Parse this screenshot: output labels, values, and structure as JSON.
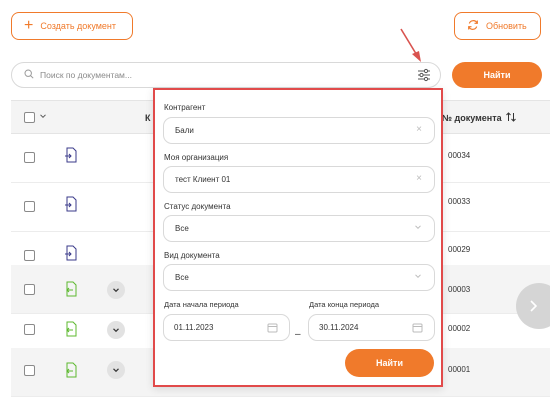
{
  "toolbar": {
    "create_label": "Создать документ",
    "refresh_label": "Обновить"
  },
  "search": {
    "placeholder": "Поиск по документам...",
    "find_label": "Найти"
  },
  "table": {
    "header_counterparty": "К",
    "header_doc_number": "№ документа",
    "rows": [
      {
        "number": "00034",
        "icon": "incoming-doc-icon",
        "expandable": false
      },
      {
        "number": "00033",
        "icon": "incoming-doc-icon",
        "expandable": false
      },
      {
        "number": "00029",
        "icon": "incoming-doc-icon",
        "expandable": false
      },
      {
        "number": "00003",
        "icon": "outgoing-doc-icon",
        "expandable": true
      },
      {
        "number": "00002",
        "icon": "outgoing-doc-icon",
        "expandable": true
      },
      {
        "number": "00001",
        "icon": "outgoing-doc-icon",
        "expandable": true
      }
    ]
  },
  "filter_panel": {
    "counterparty_label": "Контрагент",
    "counterparty_value": "Бали",
    "organization_label": "Моя организация",
    "organization_value": "тест Клиент 01",
    "status_label": "Статус документа",
    "status_value": "Все",
    "type_label": "Вид документа",
    "type_value": "Все",
    "start_label": "Дата начала периода",
    "start_value": "01.11.2023",
    "end_label": "Дата конца периода",
    "end_value": "30.11.2024",
    "dash": "–",
    "find_label": "Найти"
  },
  "colors": {
    "accent": "#f07a2b",
    "highlight_border": "#e14a4a",
    "incoming_icon": "#3a3a8a",
    "outgoing_icon": "#5cb82e"
  }
}
